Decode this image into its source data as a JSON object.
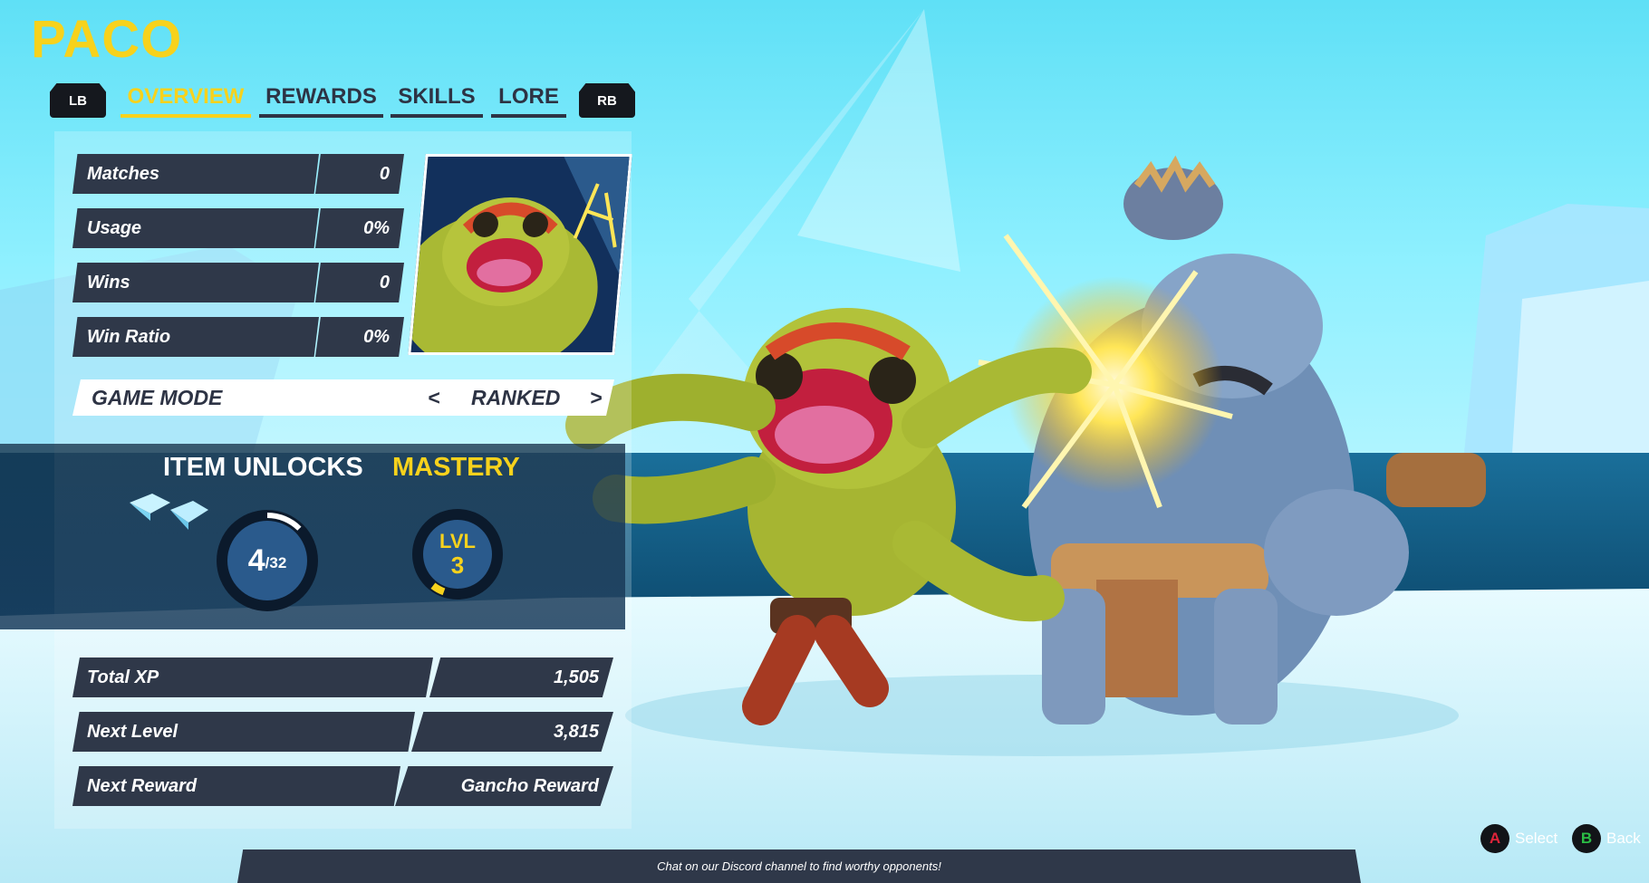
{
  "hero": {
    "name": "PACO"
  },
  "tabs": {
    "lb": "LB",
    "rb": "RB",
    "items": [
      "OVERVIEW",
      "REWARDS",
      "SKILLS",
      "LORE"
    ],
    "active": "OVERVIEW"
  },
  "stats": [
    {
      "label": "Matches",
      "value": "0"
    },
    {
      "label": "Usage",
      "value": "0%"
    },
    {
      "label": "Wins",
      "value": "0"
    },
    {
      "label": "Win Ratio",
      "value": "0%"
    }
  ],
  "game_mode": {
    "label": "GAME MODE",
    "prev": "<",
    "value": "RANKED",
    "next": ">"
  },
  "unlocks": {
    "item_title": "ITEM UNLOCKS",
    "mastery_title": "MASTERY",
    "items_unlocked": "4",
    "items_total": "/32",
    "items_fraction": 0.125,
    "level_label": "LVL",
    "level_value": "3",
    "level_progress": 0.05
  },
  "xp": [
    {
      "label": "Total XP",
      "value": "1,505"
    },
    {
      "label": "Next Level",
      "value": "3,815"
    },
    {
      "label": "Next Reward",
      "value": "Gancho Reward"
    }
  ],
  "footer": {
    "message": "Chat on our Discord channel to find worthy opponents!"
  },
  "hints": {
    "select_button": "A",
    "select_label": "Select",
    "back_button": "B",
    "back_label": "Back"
  },
  "colors": {
    "accent": "#f7d21c",
    "panel_dark": "#2f3849",
    "button_a": "#e0243a",
    "button_b": "#2bbd45"
  }
}
